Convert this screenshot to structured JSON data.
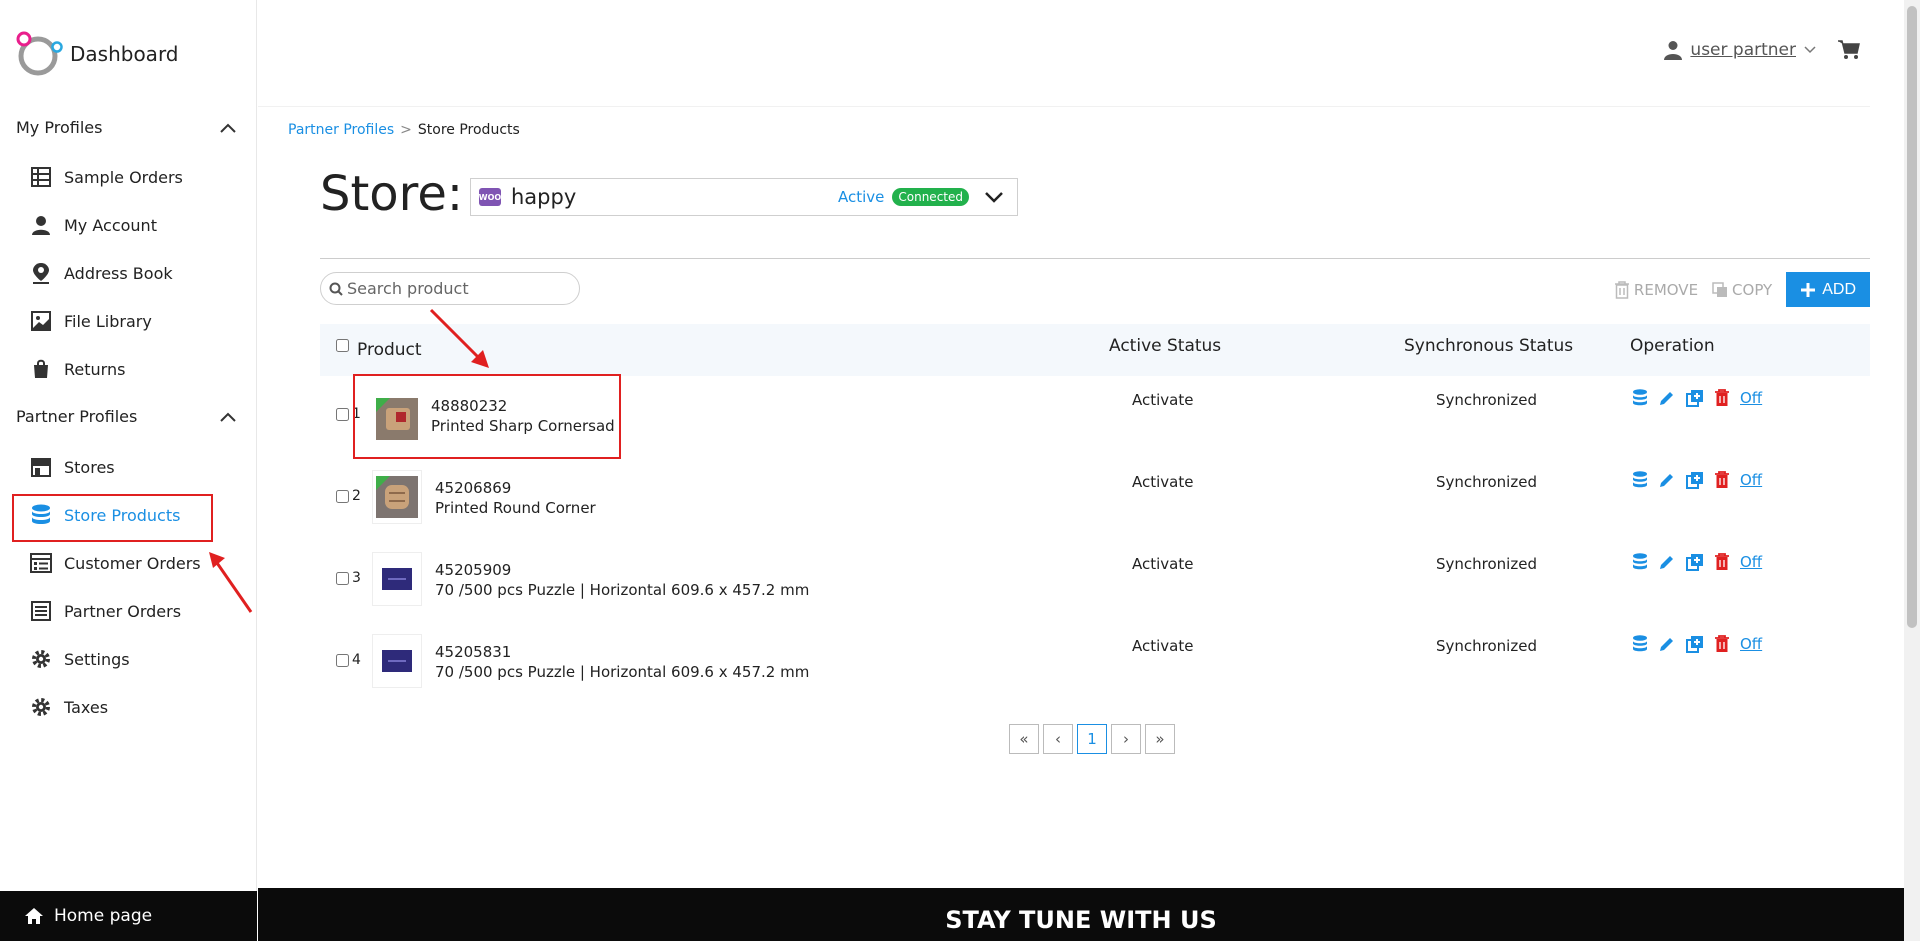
{
  "sidebar": {
    "brand": "Dashboard",
    "section_my_profiles": "My Profiles",
    "my_profiles_items": [
      "Sample Orders",
      "My Account",
      "Address Book",
      "File Library",
      "Returns"
    ],
    "section_partner_profiles": "Partner Profiles",
    "partner_items": [
      "Stores",
      "Store Products",
      "Customer Orders",
      "Partner Orders",
      "Settings",
      "Taxes"
    ],
    "home_label": "Home page"
  },
  "header": {
    "user_name": "user partner"
  },
  "breadcrumb": {
    "parent": "Partner Profiles",
    "separator": ">",
    "current": "Store Products"
  },
  "store": {
    "heading": "Store:",
    "badge": "WOO",
    "name": "happy",
    "status": "Active",
    "connection": "Connected"
  },
  "search": {
    "placeholder": "Search product"
  },
  "toolbar": {
    "remove_label": "REMOVE",
    "copy_label": "COPY",
    "add_label": "ADD"
  },
  "table": {
    "columns": [
      "Product",
      "Active Status",
      "Synchronous Status",
      "Operation"
    ],
    "rows": [
      {
        "index": "1",
        "sku": "48880232",
        "name": "Printed Sharp Cornersad",
        "active": "Activate",
        "sync": "Synchronized",
        "toggle": "Off"
      },
      {
        "index": "2",
        "sku": "45206869",
        "name": "Printed Round Corner",
        "active": "Activate",
        "sync": "Synchronized",
        "toggle": "Off"
      },
      {
        "index": "3",
        "sku": "45205909",
        "name": "70 /500 pcs Puzzle | Horizontal 609.6 x 457.2 mm",
        "active": "Activate",
        "sync": "Synchronized",
        "toggle": "Off"
      },
      {
        "index": "4",
        "sku": "45205831",
        "name": "70 /500 pcs Puzzle | Horizontal 609.6 x 457.2 mm",
        "active": "Activate",
        "sync": "Synchronized",
        "toggle": "Off"
      }
    ]
  },
  "pagination": {
    "first": "«",
    "prev": "‹",
    "current": "1",
    "next": "›",
    "last": "»"
  },
  "footer": {
    "text": "STAY TUNE WITH US"
  },
  "colors": {
    "accent": "#1a8fe3",
    "danger": "#e02020",
    "success": "#22b14c",
    "woo": "#7f54b3"
  }
}
